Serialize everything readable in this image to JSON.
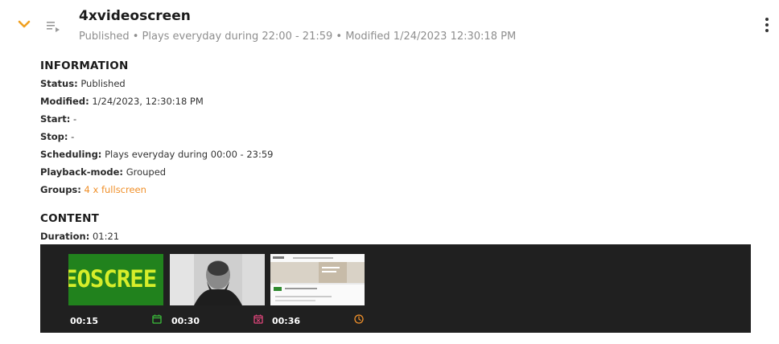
{
  "header": {
    "title": "4xvideoscreen",
    "subtitle": "Published • Plays everyday during 22:00 - 21:59 • Modified 1/24/2023 12:30:18 PM"
  },
  "information": {
    "heading": "INFORMATION",
    "status_key": "Status:",
    "status_val": "Published",
    "modified_key": "Modified:",
    "modified_val": "1/24/2023, 12:30:18 PM",
    "start_key": "Start:",
    "start_val": "-",
    "stop_key": "Stop:",
    "stop_val": "-",
    "scheduling_key": "Scheduling:",
    "scheduling_val": "Plays everyday during 00:00 - 23:59",
    "playback_key": "Playback-mode:",
    "playback_val": "Grouped",
    "groups_key": "Groups:",
    "groups_val": "4 x fullscreen"
  },
  "content": {
    "heading": "CONTENT",
    "duration_key": "Duration:",
    "duration_val": "01:21",
    "items": [
      {
        "thumb_text": "EOSCREE",
        "duration": "00:15",
        "icon": "calendar-icon",
        "icon_color": "#3bbf3b"
      },
      {
        "duration": "00:30",
        "icon": "calendar-x-icon",
        "icon_color": "#e0457b"
      },
      {
        "duration": "00:36",
        "icon": "clock-icon",
        "icon_color": "#f0902a"
      }
    ]
  },
  "colors": {
    "accent": "#f0902a",
    "strip_bg": "#202020"
  }
}
